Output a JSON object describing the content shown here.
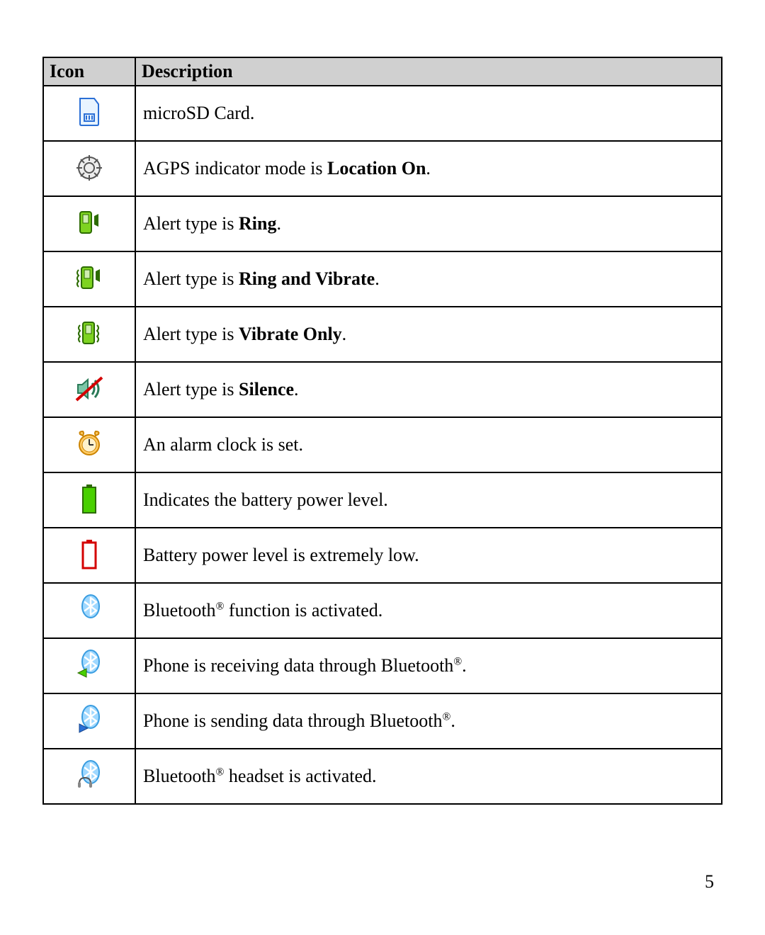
{
  "headers": {
    "icon": "Icon",
    "description": "Description"
  },
  "rows": [
    {
      "icon": "microsd-icon",
      "desc_pre": "microSD Card.",
      "desc_bold": "",
      "desc_post": "",
      "reg_in_pre": false,
      "reg_in_post": false
    },
    {
      "icon": "agps-location-on-icon",
      "desc_pre": "AGPS indicator mode is ",
      "desc_bold": "Location On",
      "desc_post": ".",
      "reg_in_pre": false,
      "reg_in_post": false
    },
    {
      "icon": "alert-ring-icon",
      "desc_pre": "Alert type is ",
      "desc_bold": "Ring",
      "desc_post": ".",
      "reg_in_pre": false,
      "reg_in_post": false
    },
    {
      "icon": "alert-ring-vibrate-icon",
      "desc_pre": "Alert type is ",
      "desc_bold": "Ring and Vibrate",
      "desc_post": ".",
      "reg_in_pre": false,
      "reg_in_post": false
    },
    {
      "icon": "alert-vibrate-only-icon",
      "desc_pre": "Alert type is ",
      "desc_bold": "Vibrate Only",
      "desc_post": ".",
      "reg_in_pre": false,
      "reg_in_post": false
    },
    {
      "icon": "alert-silence-icon",
      "desc_pre": "Alert type is ",
      "desc_bold": "Silence",
      "desc_post": ".",
      "reg_in_pre": false,
      "reg_in_post": false
    },
    {
      "icon": "alarm-clock-icon",
      "desc_pre": "An alarm clock is set.",
      "desc_bold": "",
      "desc_post": "",
      "reg_in_pre": false,
      "reg_in_post": false
    },
    {
      "icon": "battery-full-icon",
      "desc_pre": "Indicates the battery power level.",
      "desc_bold": "",
      "desc_post": "",
      "reg_in_pre": false,
      "reg_in_post": false
    },
    {
      "icon": "battery-low-icon",
      "desc_pre": "Battery power level is extremely low.",
      "desc_bold": "",
      "desc_post": "",
      "reg_in_pre": false,
      "reg_in_post": false
    },
    {
      "icon": "bluetooth-on-icon",
      "desc_pre": "Bluetooth",
      "desc_bold": "",
      "desc_post": " function is activated.",
      "reg_in_pre": true,
      "reg_in_post": false
    },
    {
      "icon": "bluetooth-receive-icon",
      "desc_pre": "Phone is receiving data through Bluetooth",
      "desc_bold": "",
      "desc_post": ".",
      "reg_in_pre": true,
      "reg_in_post": false
    },
    {
      "icon": "bluetooth-send-icon",
      "desc_pre": "Phone is sending data through Bluetooth",
      "desc_bold": "",
      "desc_post": ".",
      "reg_in_pre": true,
      "reg_in_post": false
    },
    {
      "icon": "bluetooth-headset-icon",
      "desc_pre": "Bluetooth",
      "desc_bold": "",
      "desc_post": " headset is activated.",
      "reg_in_pre": true,
      "reg_in_post": false
    }
  ],
  "page_number": "5",
  "registered_mark": "®"
}
